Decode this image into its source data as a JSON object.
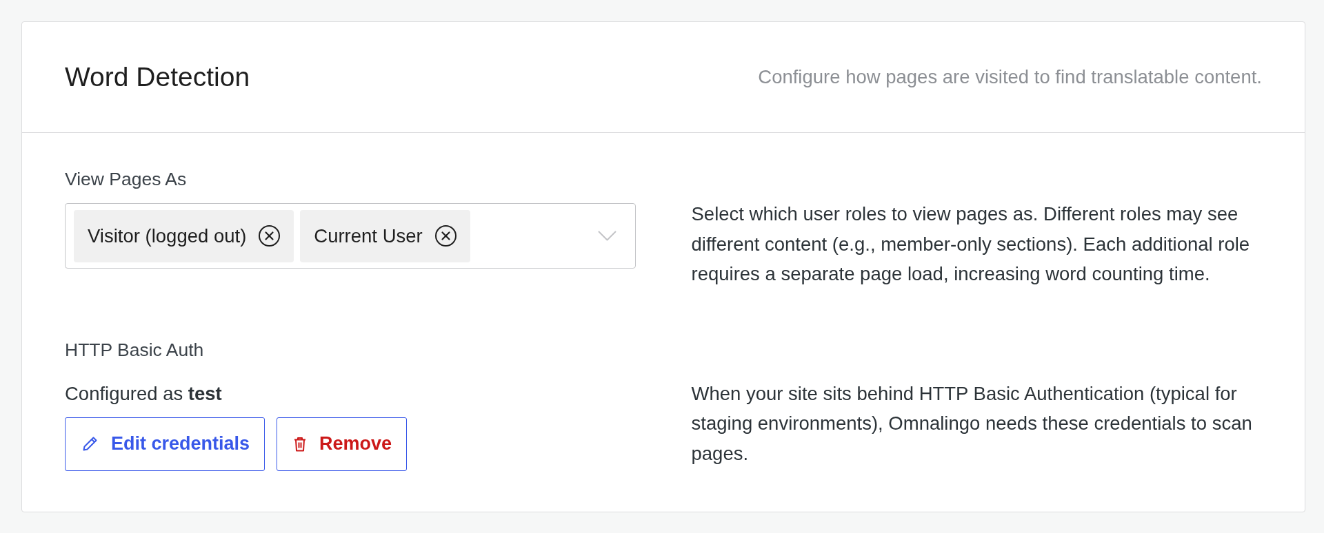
{
  "header": {
    "title": "Word Detection",
    "subtitle": "Configure how pages are visited to find translatable content."
  },
  "sections": [
    {
      "kind": "multiselect",
      "label": "View Pages As",
      "tags": [
        "Visitor (logged out)",
        "Current User"
      ],
      "description": "Select which user roles to view pages as. Different roles may see different content (e.g., member-only sections). Each additional role requires a separate page load, increasing word counting time."
    },
    {
      "kind": "credentials",
      "label": "HTTP Basic Auth",
      "status": "Configured as **test**",
      "buttons": [
        {
          "kind": "edit",
          "label": "Edit credentials"
        },
        {
          "kind": "remove",
          "label": "Remove"
        }
      ],
      "description": "When your site sits behind HTTP Basic Authentication (typical for staging environments), Omnalingo needs these credentials to scan pages."
    }
  ]
}
